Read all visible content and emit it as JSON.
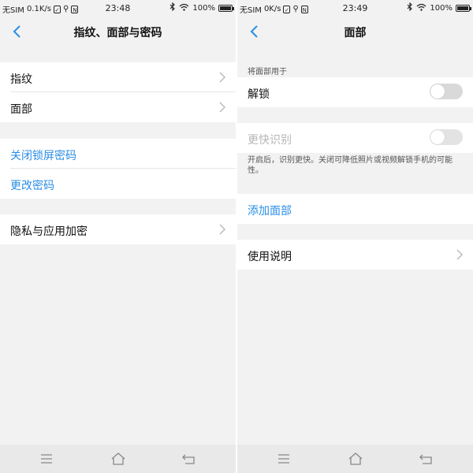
{
  "left": {
    "status": {
      "carrier": "无SIM",
      "speed": "0.1K/s",
      "time": "23:48",
      "battery": "100%",
      "battery_level": 1.0
    },
    "title": "指纹、面部与密码",
    "rows": {
      "fingerprint": "指纹",
      "face": "面部",
      "close_lock_password": "关闭锁屏密码",
      "change_password": "更改密码",
      "privacy_encryption": "隐私与应用加密"
    }
  },
  "right": {
    "status": {
      "carrier": "无SIM",
      "speed": "0K/s",
      "time": "23:49",
      "battery": "100%",
      "battery_level": 1.0
    },
    "title": "面部",
    "section_header": "将面部用于",
    "rows": {
      "unlock": "解锁",
      "faster_recognition": "更快识别",
      "add_face": "添加面部",
      "instructions": "使用说明"
    },
    "toggles": {
      "unlock": false,
      "faster_recognition": false
    },
    "note": "开启后，识别更快。关闭可降低照片或视频解锁手机的可能性。"
  },
  "icons": [
    "back-arrow-icon",
    "chevron-right-icon",
    "menu-icon",
    "home-icon",
    "return-icon",
    "wifi-icon",
    "bluetooth-icon",
    "battery-icon"
  ],
  "colors": {
    "accent": "#2a8ee6",
    "background": "#f2f2f2",
    "row_bg": "#ffffff",
    "disabled_text": "#b6b6b6"
  }
}
